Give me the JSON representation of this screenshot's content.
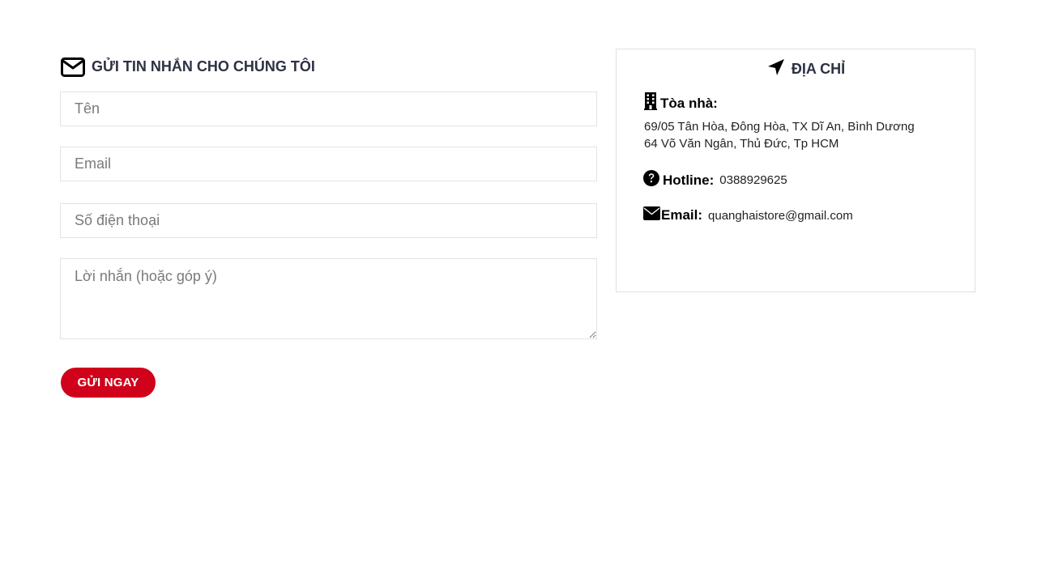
{
  "form": {
    "title": "GỬI TIN NHẮN CHO CHÚNG TÔI",
    "name_placeholder": "Tên",
    "email_placeholder": "Email",
    "phone_placeholder": "Số điện thoại",
    "message_placeholder": "Lời nhắn (hoặc góp ý)",
    "submit_label": "GỬI NGAY",
    "title_icon": "envelope-outline-icon"
  },
  "address": {
    "title": "ĐỊA CHỈ",
    "title_icon": "location-arrow-icon",
    "building_label": "Tòa nhà:",
    "building_icon": "building-icon",
    "address_lines": [
      "69/05 Tân Hòa, Đông Hòa, TX Dĩ An, Bình Dương",
      "64 Võ Văn Ngân, Thủ Đức, Tp HCM"
    ],
    "hotline_label": "Hotline:",
    "hotline_value": "0388929625",
    "hotline_icon": "question-circle-icon",
    "email_label": "Email:",
    "email_value": "quanghaistore@gmail.com",
    "email_icon": "envelope-icon"
  },
  "colors": {
    "accent": "#d0021b",
    "heading": "#2d3142",
    "border": "#e3e3e3"
  }
}
